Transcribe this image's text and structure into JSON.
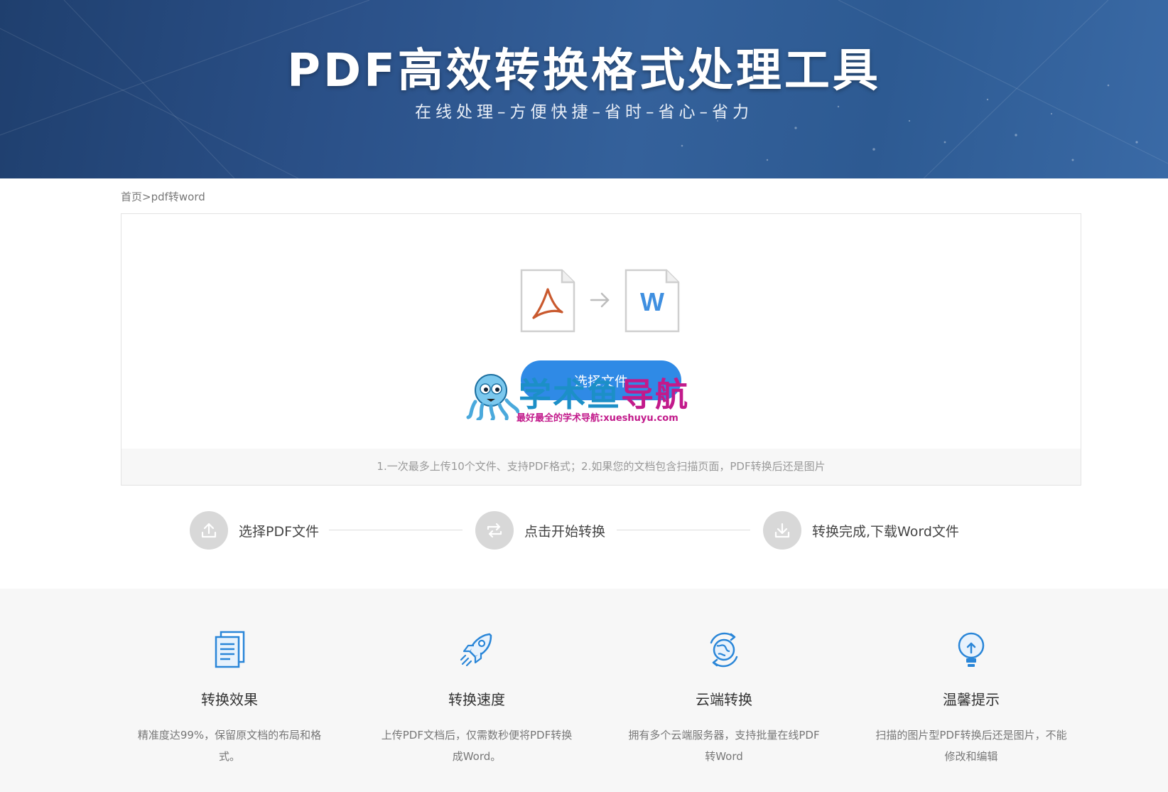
{
  "banner": {
    "title": "PDF高效转换格式处理工具",
    "subtitle": "在线处理–方便快捷–省时–省心–省力"
  },
  "breadcrumb": "首页>pdf转word",
  "upload": {
    "pdf_icon": "pdf-file-icon",
    "word_icon": "word-file-icon",
    "word_letter": "W",
    "button_label": "选择文件",
    "hint": "1.一次最多上传10个文件、支持PDF格式；2.如果您的文档包含扫描页面，PDF转换后还是图片"
  },
  "watermark": {
    "title_part1": "学术鱼",
    "title_part2": "导航",
    "slogan": "最好最全的学术导航:xueshuyu.com"
  },
  "steps": [
    {
      "label": "选择PDF文件",
      "icon": "upload-icon"
    },
    {
      "label": "点击开始转换",
      "icon": "convert-icon"
    },
    {
      "label": "转换完成,下载Word文件",
      "icon": "download-icon"
    }
  ],
  "features": [
    {
      "title": "转换效果",
      "desc": "精准度达99%，保留原文档的布局和格式。",
      "icon": "document-icon"
    },
    {
      "title": "转换速度",
      "desc": "上传PDF文档后，仅需数秒便将PDF转换成Word。",
      "icon": "rocket-icon"
    },
    {
      "title": "云端转换",
      "desc": "拥有多个云端服务器，支持批量在线PDF转Word",
      "icon": "cloud-sync-icon"
    },
    {
      "title": "温馨提示",
      "desc": "扫描的图片型PDF转换后还是图片，不能修改和编辑",
      "icon": "lightbulb-icon"
    }
  ],
  "colors": {
    "primary": "#2f8ae6",
    "icon_blue": "#2a86d8",
    "watermark_blue": "#1c8fc7",
    "watermark_magenta": "#c21a8b"
  }
}
